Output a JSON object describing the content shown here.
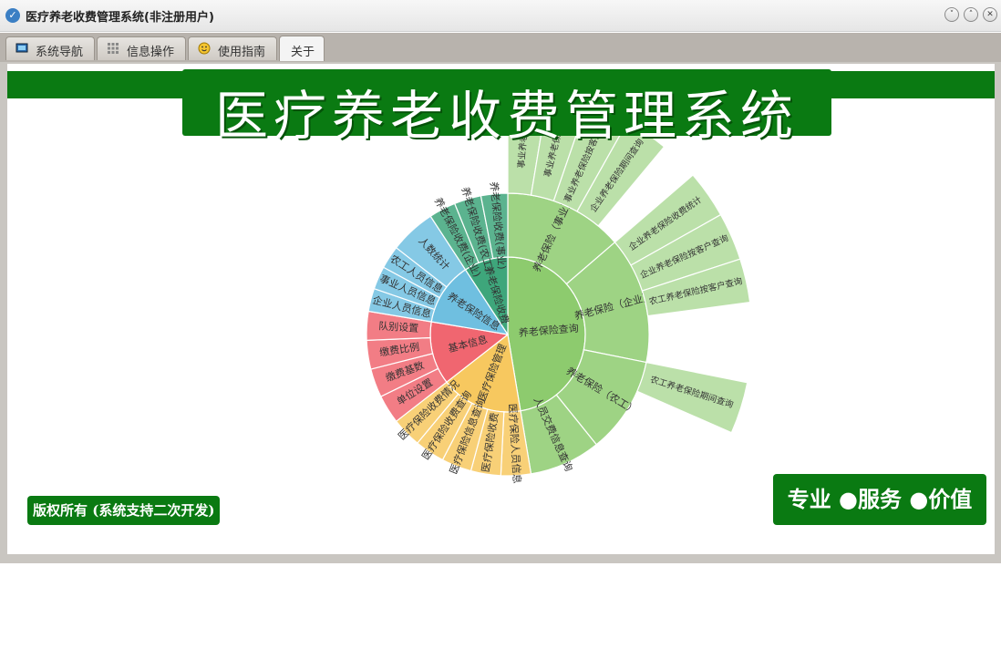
{
  "window": {
    "title": "医疗养老收费管理系统(非注册用户)",
    "controls": [
      "minimize",
      "maximize",
      "close"
    ]
  },
  "tabs": [
    {
      "label": "系统导航",
      "icon": "monitor-icon"
    },
    {
      "label": "信息操作",
      "icon": "grid-icon"
    },
    {
      "label": "使用指南",
      "icon": "smiley-icon"
    },
    {
      "label": "关于",
      "active": true
    }
  ],
  "banner": {
    "title": "医疗养老收费管理系统"
  },
  "footer": {
    "copyright": "版权所有 (系统支持二次开发)",
    "slogan": "专业 ●服务 ●价值"
  },
  "colors": {
    "brand_green": "#0a7a12",
    "green": "#8dcb6e",
    "pink": "#f06670",
    "yellow": "#f7c85f",
    "blue": "#6fbfe0",
    "teal": "#3ea67b"
  },
  "chart_data": {
    "type": "sunburst",
    "start_angle_deg": -90,
    "children": [
      {
        "name": "养老保险查询",
        "value": 180,
        "color": "#8dcb6e",
        "children": [
          {
            "name": "养老保险（事业）",
            "value": 52,
            "children": [
              {
                "name": "事业养老保险",
                "value": 10
              },
              {
                "name": "事业养老保险收",
                "value": 10
              },
              {
                "name": "事业养老保险按客户查询",
                "value": 11
              },
              {
                "name": "企业养老保险期间查询",
                "value": 11
              }
            ]
          },
          {
            "name": "养老保险（企业）",
            "value": 55,
            "children": [
              {
                "name": "企业养老保险收费统计",
                "value": 12
              },
              {
                "name": "企业养老保险按客户查询",
                "value": 12
              },
              {
                "name": "农工养老保险按客户查询",
                "value": 11
              }
            ]
          },
          {
            "name": "养老保险（农工）",
            "value": 42,
            "children": [
              {
                "name": "农工养老保险期间查询",
                "value": 13
              }
            ]
          },
          {
            "name": "人员交费信息查询",
            "value": 31
          }
        ]
      },
      {
        "name": "医疗保险管理",
        "value": 65,
        "color": "#f7c85f",
        "children": [
          {
            "name": "医疗保险人员信息",
            "value": 13
          },
          {
            "name": "医疗保险收费",
            "value": 13
          },
          {
            "name": "医疗保险信息查询",
            "value": 13
          },
          {
            "name": "医疗保险收费查询",
            "value": 13
          },
          {
            "name": "医疗保险收费情况",
            "value": 13
          }
        ]
      },
      {
        "name": "基本信息",
        "value": 50,
        "color": "#f06670",
        "children": [
          {
            "name": "单位设置",
            "value": 12.5
          },
          {
            "name": "缴费基数",
            "value": 12.5
          },
          {
            "name": "缴费比例",
            "value": 12.5
          },
          {
            "name": "队别设置",
            "value": 12.5
          }
        ]
      },
      {
        "name": "养老保险信息",
        "value": 50,
        "color": "#6fbfe0",
        "children": [
          {
            "name": "企业人员信息",
            "value": 10
          },
          {
            "name": "事业人员信息",
            "value": 10
          },
          {
            "name": "农工人员信息",
            "value": 10
          },
          {
            "name": "人数统计",
            "value": 20
          }
        ]
      },
      {
        "name": "养老保险收费",
        "value": 35,
        "color": "#3ea67b",
        "children": [
          {
            "name": "养老保险收费(企业)",
            "value": 11.7
          },
          {
            "name": "养老保险收费(农工)",
            "value": 11.7
          },
          {
            "name": "养老保险收费(事业)",
            "value": 11.6
          }
        ]
      }
    ]
  }
}
